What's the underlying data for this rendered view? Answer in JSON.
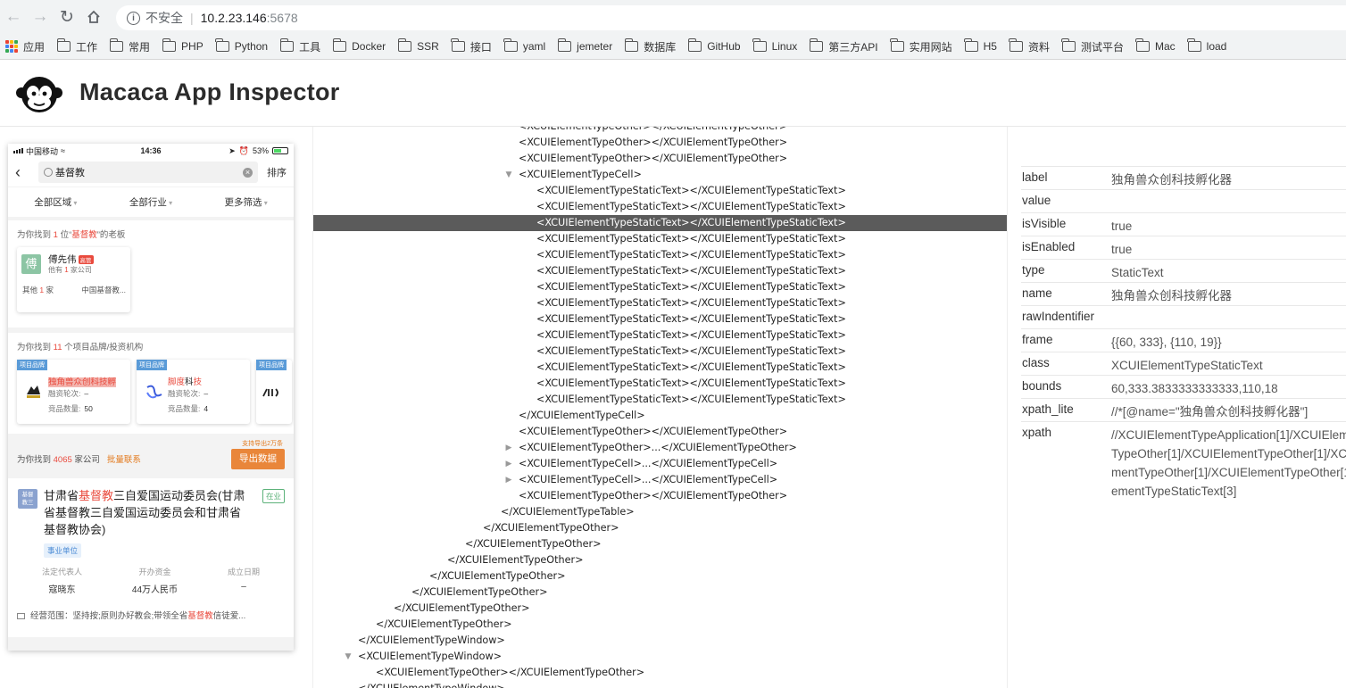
{
  "browser": {
    "insecure_label": "不安全",
    "url_host": "10.2.23.146",
    "url_port": ":5678",
    "apps_label": "应用",
    "bookmarks": [
      "工作",
      "常用",
      "PHP",
      "Python",
      "工具",
      "Docker",
      "SSR",
      "接口",
      "yaml",
      "jemeter",
      "数据库",
      "GitHub",
      "Linux",
      "第三方API",
      "实用网站",
      "H5",
      "资料",
      "测试平台",
      "Mac",
      "load"
    ]
  },
  "app": {
    "title": "Macaca App Inspector"
  },
  "phone": {
    "carrier": "中国移动",
    "time": "14:36",
    "battery": "53%",
    "search_query": "基督教",
    "sort_label": "排序",
    "filters": [
      "全部区域",
      "全部行业",
      "更多筛选"
    ],
    "boss_hint_pre": "为你找到 ",
    "boss_hint_num": "1",
    "boss_hint_mid": " 位“",
    "boss_hint_kw": "基督教",
    "boss_hint_post": "”的老板",
    "person": {
      "avatar": "傅",
      "name": "傅先伟",
      "tag": "高管",
      "sub_pre": "他有 ",
      "sub_num": "1",
      "sub_post": " 家公司",
      "other_pre": "其他 ",
      "other_num": "1",
      "other_post": " 家",
      "company": "中国基督教..."
    },
    "brand_hint_pre": "为你找到 ",
    "brand_hint_num": "11",
    "brand_hint_post": " 个项目品牌/投资机构",
    "brands": [
      {
        "tag": "项目品牌",
        "name_hl": "独角兽众创科技孵",
        "info1_k": "融资轮次:",
        "info1_v": "–",
        "info2_k": "竞品数量:",
        "info2_v": "50"
      },
      {
        "tag": "项目品牌",
        "name_a": "脚度",
        "name_b": "科",
        "name_c": "技",
        "info1_k": "融资轮次:",
        "info1_v": "–",
        "info2_k": "竞品数量:",
        "info2_v": "4"
      },
      {
        "tag": "项目品牌"
      }
    ],
    "company_hint_pre": "为你找到 ",
    "company_hint_num": "4065",
    "company_hint_post": " 家公司",
    "bulk_contact": "批量联系",
    "export_tip": "支持导出2万条",
    "export_btn": "导出数据",
    "org": {
      "icon_line1": "基督",
      "icon_line2": "教三",
      "name_a": "甘肃省",
      "name_kw": "基督教",
      "name_b": "三自爱国运动委员会(甘肃省基督教三自爱国运动委员会和甘肃省基督教协会)",
      "status": "在业",
      "type": "事业单位",
      "cols": [
        {
          "k": "法定代表人",
          "v": "寇晓东"
        },
        {
          "k": "开办资金",
          "v": "44万人民币"
        },
        {
          "k": "成立日期",
          "v": "–"
        }
      ],
      "scope_a": "经营范围：坚持按;原则办好教会;带领全省",
      "scope_kw": "基督教",
      "scope_b": "信徒爱..."
    }
  },
  "tree": [
    {
      "text": "<XCUIElementTypeOther></XCUIElementTypeOther>",
      "indent": 580,
      "tw": ""
    },
    {
      "text": "<XCUIElementTypeOther></XCUIElementTypeOther>",
      "indent": 580,
      "tw": ""
    },
    {
      "text": "<XCUIElementTypeOther></XCUIElementTypeOther>",
      "indent": 580,
      "tw": ""
    },
    {
      "text": "<XCUIElementTypeCell>",
      "indent": 580,
      "tw": "▼"
    },
    {
      "text": "<XCUIElementTypeStaticText></XCUIElementTypeStaticText>",
      "indent": 600,
      "tw": ""
    },
    {
      "text": "<XCUIElementTypeStaticText></XCUIElementTypeStaticText>",
      "indent": 600,
      "tw": ""
    },
    {
      "text": "<XCUIElementTypeStaticText></XCUIElementTypeStaticText>",
      "indent": 600,
      "tw": "",
      "selected": true
    },
    {
      "text": "<XCUIElementTypeStaticText></XCUIElementTypeStaticText>",
      "indent": 600,
      "tw": ""
    },
    {
      "text": "<XCUIElementTypeStaticText></XCUIElementTypeStaticText>",
      "indent": 600,
      "tw": ""
    },
    {
      "text": "<XCUIElementTypeStaticText></XCUIElementTypeStaticText>",
      "indent": 600,
      "tw": ""
    },
    {
      "text": "<XCUIElementTypeStaticText></XCUIElementTypeStaticText>",
      "indent": 600,
      "tw": ""
    },
    {
      "text": "<XCUIElementTypeStaticText></XCUIElementTypeStaticText>",
      "indent": 600,
      "tw": ""
    },
    {
      "text": "<XCUIElementTypeStaticText></XCUIElementTypeStaticText>",
      "indent": 600,
      "tw": ""
    },
    {
      "text": "<XCUIElementTypeStaticText></XCUIElementTypeStaticText>",
      "indent": 600,
      "tw": ""
    },
    {
      "text": "<XCUIElementTypeStaticText></XCUIElementTypeStaticText>",
      "indent": 600,
      "tw": ""
    },
    {
      "text": "<XCUIElementTypeStaticText></XCUIElementTypeStaticText>",
      "indent": 600,
      "tw": ""
    },
    {
      "text": "<XCUIElementTypeStaticText></XCUIElementTypeStaticText>",
      "indent": 600,
      "tw": ""
    },
    {
      "text": "<XCUIElementTypeStaticText></XCUIElementTypeStaticText>",
      "indent": 600,
      "tw": ""
    },
    {
      "text": "</XCUIElementTypeCell>",
      "indent": 580,
      "tw": ""
    },
    {
      "text": "<XCUIElementTypeOther></XCUIElementTypeOther>",
      "indent": 580,
      "tw": ""
    },
    {
      "text": "<XCUIElementTypeOther>...</XCUIElementTypeOther>",
      "indent": 580,
      "tw": "▶"
    },
    {
      "text": "<XCUIElementTypeCell>...</XCUIElementTypeCell>",
      "indent": 580,
      "tw": "▶"
    },
    {
      "text": "<XCUIElementTypeCell>...</XCUIElementTypeCell>",
      "indent": 580,
      "tw": "▶"
    },
    {
      "text": "<XCUIElementTypeOther></XCUIElementTypeOther>",
      "indent": 580,
      "tw": ""
    },
    {
      "text": "</XCUIElementTypeTable>",
      "indent": 560,
      "tw": ""
    },
    {
      "text": "</XCUIElementTypeOther>",
      "indent": 540,
      "tw": ""
    },
    {
      "text": "</XCUIElementTypeOther>",
      "indent": 520,
      "tw": ""
    },
    {
      "text": "</XCUIElementTypeOther>",
      "indent": 500,
      "tw": ""
    },
    {
      "text": "</XCUIElementTypeOther>",
      "indent": 480,
      "tw": ""
    },
    {
      "text": "</XCUIElementTypeOther>",
      "indent": 460,
      "tw": ""
    },
    {
      "text": "</XCUIElementTypeOther>",
      "indent": 440,
      "tw": ""
    },
    {
      "text": "</XCUIElementTypeOther>",
      "indent": 420,
      "tw": ""
    },
    {
      "text": "</XCUIElementTypeWindow>",
      "indent": 400,
      "tw": ""
    },
    {
      "text": "<XCUIElementTypeWindow>",
      "indent": 400,
      "tw": "▼"
    },
    {
      "text": "<XCUIElementTypeOther></XCUIElementTypeOther>",
      "indent": 420,
      "tw": ""
    },
    {
      "text": "</XCUIElementTypeWindow>",
      "indent": 400,
      "tw": ""
    },
    {
      "text": "<XCUIElementTypeWindow>",
      "indent": 400,
      "tw": "▼"
    }
  ],
  "attributes": [
    {
      "key": "label",
      "value": "独角兽众创科技孵化器"
    },
    {
      "key": "value",
      "value": ""
    },
    {
      "key": "isVisible",
      "value": "true"
    },
    {
      "key": "isEnabled",
      "value": "true"
    },
    {
      "key": "type",
      "value": "StaticText"
    },
    {
      "key": "name",
      "value": "独角兽众创科技孵化器"
    },
    {
      "key": "rawIndentifier",
      "value": ""
    },
    {
      "key": "frame",
      "value": "{{60, 333}, {110, 19}}"
    },
    {
      "key": "class",
      "value": "XCUIElementTypeStaticText"
    },
    {
      "key": "bounds",
      "value": "60,333.3833333333333,110,18"
    },
    {
      "key": "xpath_lite",
      "value": "//*[@name=\"独角兽众创科技孵化器\"]"
    },
    {
      "key": "xpath",
      "value": "//XCUIElementTypeApplication[1]/XCUIElementTypeWindow[1]/XCUIElementTypeOther[1]/XCUIElementTypeOther[1]/XCUIElementTypeOther[1]/XCUIElementTypeOther[1]/XCUIElementTypeOther[1]/XCUIElementTypeTable[1]/XCUIElementTypeCell[1]/XCUIElementTypeStaticText[3]",
      "xpath_lines": [
        "//XCUIElementTypeApplication[1]/XCUIElementTy",
        "TypeOther[1]/XCUIElementTypeOther[1]/XCUIEl",
        "mentTypeOther[1]/XCUIElementTypeOther[1]/XCUIEl",
        "ementTypeStaticText[3]"
      ]
    }
  ]
}
